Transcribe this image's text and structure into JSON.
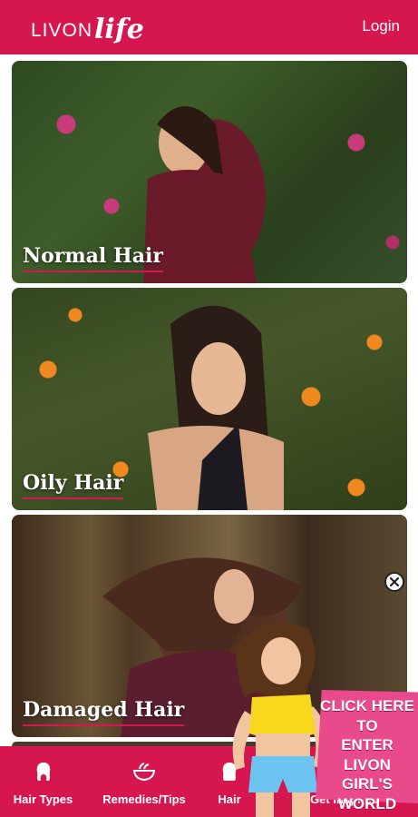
{
  "header": {
    "brand": "LIVON",
    "brand_script": "life",
    "login_label": "Login"
  },
  "cards": [
    {
      "title": "Normal Hair"
    },
    {
      "title": "Oily Hair"
    },
    {
      "title": "Damaged Hair"
    }
  ],
  "promo": {
    "text": "CLICK HERE\nTO\nENTER\nLIVON GIRL'S\nWORLD",
    "close_icon": "close-circle-icon"
  },
  "bottom_nav": [
    {
      "label": "Hair Types",
      "icon": "hair-icon"
    },
    {
      "label": "Remedies/Tips",
      "icon": "bowl-icon"
    },
    {
      "label": "Hair",
      "icon": "hair-icon"
    },
    {
      "label": "Get Inspired",
      "icon": "lightbulb-icon"
    }
  ],
  "colors": {
    "brand": "#d6174f",
    "promo": "#e84a8c"
  }
}
